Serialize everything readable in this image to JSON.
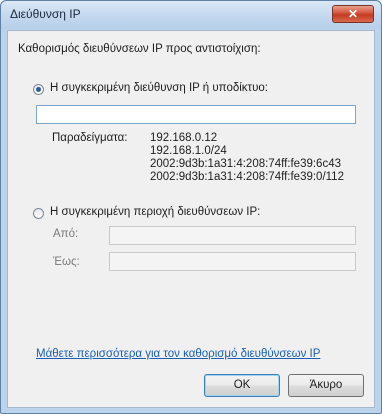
{
  "window": {
    "title": "Διεύθυνση IP",
    "close_symbol": "✕"
  },
  "heading": "Καθορισμός διευθύνσεων IP προς αντιστοίχιση:",
  "option_specific": {
    "label": "Η συγκεκριμένη διεύθυνση IP ή υποδίκτυο:",
    "selected": true,
    "input_value": ""
  },
  "examples": {
    "label": "Παραδείγματα:",
    "items": [
      "192.168.0.12",
      "192.168.1.0/24",
      "2002:9d3b:1a31:4:208:74ff:fe39:6c43",
      "2002:9d3b:1a31:4:208:74ff:fe39:0/112"
    ]
  },
  "option_range": {
    "label": "Η συγκεκριμένη περιοχή διευθύνσεων IP:",
    "selected": false,
    "from_label": "Από:",
    "to_label": "Έως:",
    "from_value": "",
    "to_value": ""
  },
  "learn_more_link": "Μάθετε περισσότερα για τον καθορισμό διευθύνσεων IP",
  "buttons": {
    "ok": "OK",
    "cancel": "Άκυρο"
  }
}
